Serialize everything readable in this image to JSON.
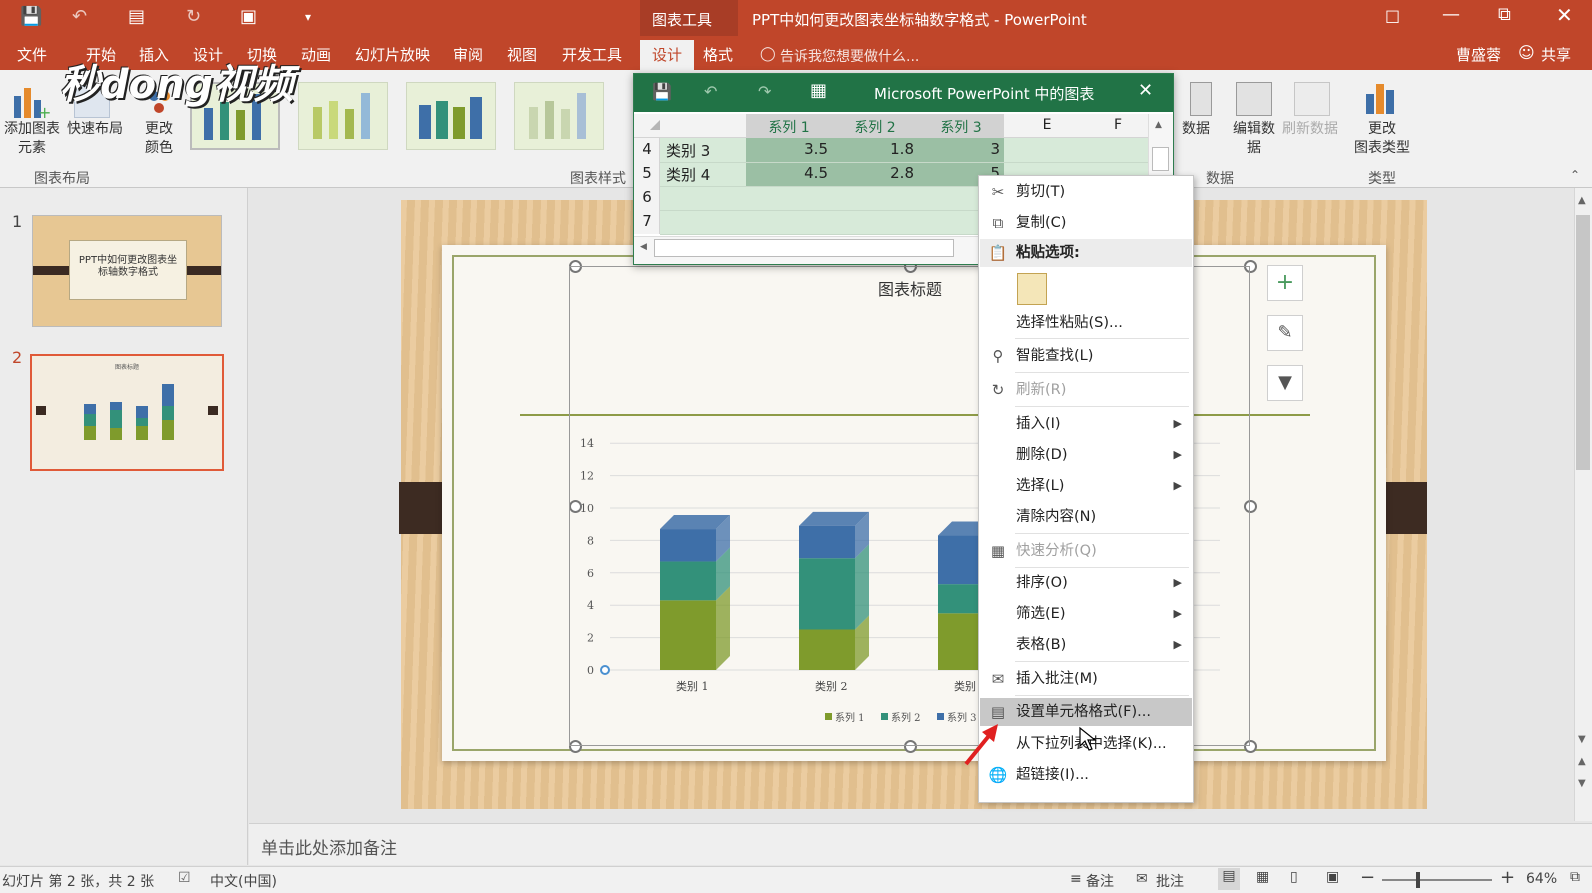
{
  "app": {
    "window_title": "PPT中如何更改图表坐标轴数字格式 - PowerPoint",
    "context_title": "图表工具",
    "user": "曹盛蓉",
    "share": "共享",
    "search_hint": "告诉我您想要做什么...",
    "watermark": "秒dong视频"
  },
  "tabs": [
    {
      "label": "文件"
    },
    {
      "label": "开始"
    },
    {
      "label": "插入"
    },
    {
      "label": "设计"
    },
    {
      "label": "切换"
    },
    {
      "label": "动画"
    },
    {
      "label": "幻灯片放映"
    },
    {
      "label": "审阅"
    },
    {
      "label": "视图"
    },
    {
      "label": "开发工具"
    },
    {
      "label": "设计"
    },
    {
      "label": "格式"
    }
  ],
  "ribbon": {
    "add_element": "添加图表\n元素",
    "quick_layout": "快速布局",
    "change_colors": "更改\n颜色",
    "group_layout": "图表布局",
    "group_styles": "图表样式",
    "switch_data": "数据",
    "edit_data": "编辑数\n据",
    "refresh_data": "刷新数据",
    "group_data": "数据",
    "change_type": "更改\n图表类型",
    "group_type": "类型"
  },
  "slides": [
    {
      "number": "1",
      "title": "PPT中如何更改图表坐标轴数字格式"
    },
    {
      "number": "2",
      "title": "图表标题"
    }
  ],
  "sheet": {
    "title": "Microsoft PowerPoint 中的图表",
    "col_headers": [
      "系列 1",
      "系列 2",
      "系列 3",
      "E",
      "F"
    ],
    "rows": [
      {
        "num": "4",
        "label": "类别 3",
        "v1": "3.5",
        "v2": "1.8",
        "v3": "3"
      },
      {
        "num": "5",
        "label": "类别 4",
        "v1": "4.5",
        "v2": "2.8",
        "v3": "5"
      },
      {
        "num": "6",
        "label": "",
        "v1": "",
        "v2": "",
        "v3": ""
      },
      {
        "num": "7",
        "label": "",
        "v1": "",
        "v2": "",
        "v3": ""
      }
    ]
  },
  "context_menu": {
    "items": [
      {
        "label": "剪切(T)",
        "icon": "scissors-icon"
      },
      {
        "label": "复制(C)",
        "icon": "copy-icon"
      },
      {
        "label": "粘贴选项:",
        "icon": "paste-icon"
      },
      {
        "label": "选择性粘贴(S)..."
      },
      {
        "label": "智能查找(L)",
        "icon": "search-icon"
      },
      {
        "label": "刷新(R)",
        "icon": "refresh-icon"
      },
      {
        "label": "插入(I)"
      },
      {
        "label": "删除(D)"
      },
      {
        "label": "选择(L)"
      },
      {
        "label": "清除内容(N)"
      },
      {
        "label": "快速分析(Q)",
        "icon": "quick-analysis-icon"
      },
      {
        "label": "排序(O)"
      },
      {
        "label": "筛选(E)"
      },
      {
        "label": "表格(B)"
      },
      {
        "label": "插入批注(M)",
        "icon": "comment-icon"
      },
      {
        "label": "设置单元格格式(F)...",
        "icon": "format-cells-icon"
      },
      {
        "label": "从下拉列表中选择(K)..."
      },
      {
        "label": "超链接(I)...",
        "icon": "hyperlink-icon"
      }
    ]
  },
  "chart_data": {
    "type": "bar",
    "title": "图表标题",
    "categories": [
      "类别 1",
      "类别 2",
      "类别 3",
      "类别 4"
    ],
    "series": [
      {
        "name": "系列 1",
        "values": [
          4.3,
          2.5,
          3.5,
          4.5
        ]
      },
      {
        "name": "系列 2",
        "values": [
          2.4,
          4.4,
          1.8,
          2.8
        ]
      },
      {
        "name": "系列 3",
        "values": [
          2,
          2,
          3,
          5
        ]
      }
    ],
    "ylim": [
      0,
      14
    ],
    "yticks": [
      "0",
      "2",
      "4",
      "6",
      "8",
      "10",
      "12",
      "14"
    ],
    "legend_position": "bottom",
    "colors": [
      "#7f9b2c",
      "#33917a",
      "#3e6fa8"
    ]
  },
  "notes": {
    "placeholder": "单击此处添加备注"
  },
  "status": {
    "slide_info": "幻灯片 第 2 张，共 2 张",
    "language": "中文(中国)",
    "notes_btn": "备注",
    "comments_btn": "批注",
    "zoom": "64%"
  },
  "colors": {
    "accent": "#c0462a",
    "excel_green": "#217346"
  }
}
